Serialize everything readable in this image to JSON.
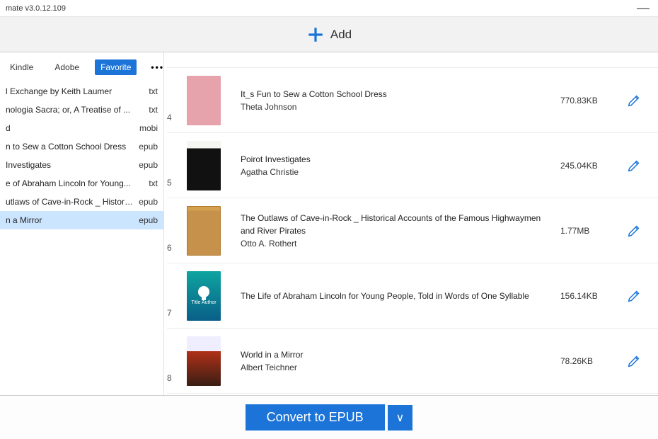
{
  "window": {
    "title": "mate v3.0.12.109",
    "minimize": "—"
  },
  "toolbar": {
    "add_label": "Add"
  },
  "sidebar": {
    "tabs": {
      "kindle": "Kindle",
      "adobe": "Adobe",
      "favorite": "Favorite",
      "more": "•••"
    },
    "items": [
      {
        "title": "l Exchange by Keith Laumer",
        "format": "txt"
      },
      {
        "title": "nologia Sacra; or, A Treatise of ...",
        "format": "txt"
      },
      {
        "title": "d",
        "format": "mobi"
      },
      {
        "title": "n to Sew a Cotton School Dress",
        "format": "epub"
      },
      {
        "title": "Investigates",
        "format": "epub"
      },
      {
        "title": "e of Abraham Lincoln for Young...",
        "format": "txt"
      },
      {
        "title": "utlaws of Cave-in-Rock _ Histori...",
        "format": "epub"
      },
      {
        "title": "n a Mirror",
        "format": "epub"
      }
    ]
  },
  "books": [
    {
      "idx": "4",
      "title": "It_s Fun to Sew a Cotton School Dress",
      "author": "Theta Johnson",
      "size": "770.83KB",
      "cover": "pink"
    },
    {
      "idx": "5",
      "title": "Poirot Investigates",
      "author": "Agatha Christie",
      "size": "245.04KB",
      "cover": "dark"
    },
    {
      "idx": "6",
      "title": "The Outlaws of Cave-in-Rock _ Historical Accounts of the Famous Highwaymen and River Pirates",
      "author": "Otto A. Rothert",
      "size": "1.77MB",
      "cover": "tan"
    },
    {
      "idx": "7",
      "title": "The Life of Abraham Lincoln for Young People, Told in Words of One Syllable",
      "author": "",
      "size": "156.14KB",
      "cover": "teal"
    },
    {
      "idx": "8",
      "title": "World in a Mirror",
      "author": "Albert Teichner",
      "size": "78.26KB",
      "cover": "sci"
    }
  ],
  "teal_cover_text": "Title Author",
  "footer": {
    "convert_label": "Convert to EPUB",
    "dropdown": "∨"
  }
}
